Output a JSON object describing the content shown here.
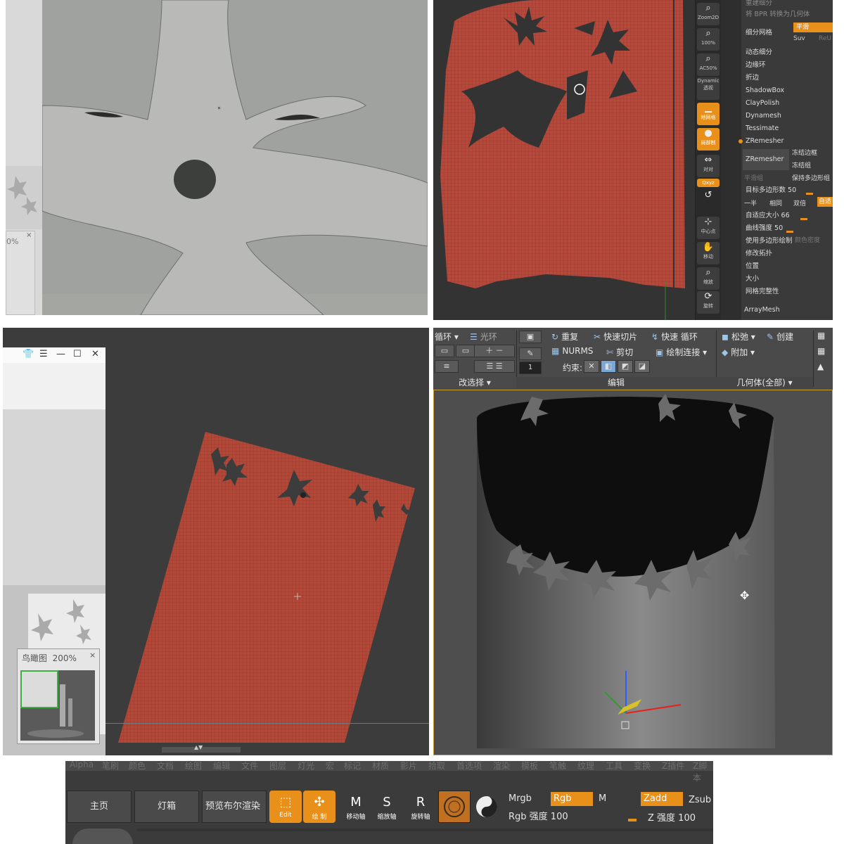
{
  "panel1": {
    "navigator_zoom": "0%",
    "close_glyph": "×"
  },
  "panel2": {
    "shelf": [
      {
        "icon": "zoom-2d-icon",
        "label": "Zoom2D",
        "active": false
      },
      {
        "icon": "zoom-100-icon",
        "label": "100%",
        "active": false
      },
      {
        "icon": "ac50-icon",
        "label": "AC50%",
        "active": false
      },
      {
        "icon": "dynamic-perspective-icon",
        "label": "Dynamic 透视",
        "active": false
      },
      {
        "icon": "floor-grid-icon",
        "label": "地网格",
        "active": true
      },
      {
        "icon": "local-icon",
        "label": "局部制",
        "active": true
      },
      {
        "icon": "align-icon",
        "label": "对对",
        "active": false
      },
      {
        "icon": "xyz-icon",
        "label": "Qxyz",
        "active": true
      },
      {
        "icon": "rotate-small-icon",
        "label": "",
        "active": false
      },
      {
        "icon": "frame-center-icon",
        "label": "中心点",
        "active": false
      },
      {
        "icon": "move-icon",
        "label": "移动",
        "active": false
      },
      {
        "icon": "scale-icon",
        "label": "缩放",
        "active": false
      },
      {
        "icon": "rotate-icon",
        "label": "旋转",
        "active": false
      }
    ],
    "menu": [
      {
        "label": "重建细分",
        "dim": true
      },
      {
        "label": "将 BPR 转换为几何体",
        "dim": true
      },
      {
        "label": "细分网格",
        "dim": false
      },
      {
        "label": "动态细分",
        "dim": false
      },
      {
        "label": "边缘环",
        "dim": false
      },
      {
        "label": "折边",
        "dim": false
      },
      {
        "label": "ShadowBox",
        "dim": false
      },
      {
        "label": "ClayPolish",
        "dim": false
      },
      {
        "label": "Dynamesh",
        "dim": false
      },
      {
        "label": "Tessimate",
        "dim": false
      },
      {
        "label": "ZRemesher",
        "dim": false
      }
    ],
    "subdiv_tags": [
      "平滑",
      "Suv",
      "ReU"
    ],
    "zremesher_button": "ZRemesher",
    "zremesher_options": [
      "冻结边框",
      "冻结组",
      "保持多边形组"
    ],
    "smooth_groups": "平滑组",
    "target_polycount_label": "目标多边形数",
    "target_polycount_value": "50",
    "half_same_double": [
      "一半",
      "相同",
      "双倍",
      "自适"
    ],
    "adaptive_size_label": "自适应大小",
    "adaptive_size_value": "66",
    "curve_strength_label": "曲线强度",
    "curve_strength_value": "50",
    "use_polypaint": "使用多边形绘制",
    "color_density": "颜色密度",
    "lower_menu": [
      "修改拓扑",
      "位置",
      "大小",
      "网格完整性"
    ],
    "array_mesh": "ArrayMesh"
  },
  "panel3": {
    "window_icons": [
      "👕",
      "☰",
      "—",
      "☐",
      "✕"
    ],
    "navigator_title": "鸟瞰图",
    "navigator_zoom": "200%",
    "close_glyph": "×",
    "scroll_glyph": "▲▼"
  },
  "panel4": {
    "row1": [
      {
        "icon": "redo-icon",
        "glyph": "↻",
        "label": "重复"
      },
      {
        "icon": "quick-slice-icon",
        "glyph": "✂",
        "label": "快速切片"
      },
      {
        "icon": "quick-loop-icon",
        "glyph": "↯",
        "label": "快速 循环"
      },
      {
        "icon": "relax-icon",
        "glyph": "◼",
        "label": "松弛 ▾"
      },
      {
        "icon": "create-icon",
        "glyph": "✎",
        "label": "创建"
      }
    ],
    "row2": [
      {
        "icon": "nurms-icon",
        "glyph": "▦",
        "label": "NURMS"
      },
      {
        "icon": "cut-icon",
        "glyph": "✄",
        "label": "剪切"
      },
      {
        "icon": "paint-connect-icon",
        "glyph": "▣",
        "label": "绘制连接 ▾"
      },
      {
        "icon": "attach-icon",
        "glyph": "◆",
        "label": "附加 ▾"
      }
    ],
    "constraint_label": "约束:",
    "loop_label": "循环 ▾",
    "ring_label": "光环",
    "spinner_value": "1",
    "sections": [
      "改选择 ▾",
      "编辑",
      "几何体(全部) ▾"
    ]
  },
  "panel5": {
    "menus": [
      "Alpha",
      "笔刷",
      "颜色",
      "文档",
      "绘图",
      "编辑",
      "文件",
      "图层",
      "灯光",
      "宏",
      "标记",
      "材质",
      "影片",
      "拾取",
      "首选项",
      "渲染",
      "模板",
      "笔触",
      "纹理",
      "工具",
      "变换",
      "Z插件",
      "Z脚本"
    ],
    "nav_buttons": [
      "主页",
      "灯箱",
      "预览布尔渲染"
    ],
    "tools": [
      {
        "icon": "edit-icon",
        "glyph": "⬚",
        "label": "Edit",
        "active": true
      },
      {
        "icon": "draw-icon",
        "glyph": "✣",
        "label": "绘 制",
        "active": true
      },
      {
        "icon": "move-tool-icon",
        "glyph": "M",
        "label": "移动轴",
        "active": false
      },
      {
        "icon": "scale-tool-icon",
        "glyph": "S",
        "label": "缩放轴",
        "active": false
      },
      {
        "icon": "rotate-tool-icon",
        "glyph": "R",
        "label": "旋转轴",
        "active": false
      }
    ],
    "mrgb": "Mrgb",
    "rgb": "Rgb",
    "m": "M",
    "zadd": "Zadd",
    "zsub": "Zsub",
    "rgb_intensity": "Rgb 强度 100",
    "z_intensity": "Z 强度 100"
  },
  "colors": {
    "zbrush_orange": "#e8901a",
    "mesh_red": "#b54a3c",
    "max_blue": "#9ec4ea"
  }
}
